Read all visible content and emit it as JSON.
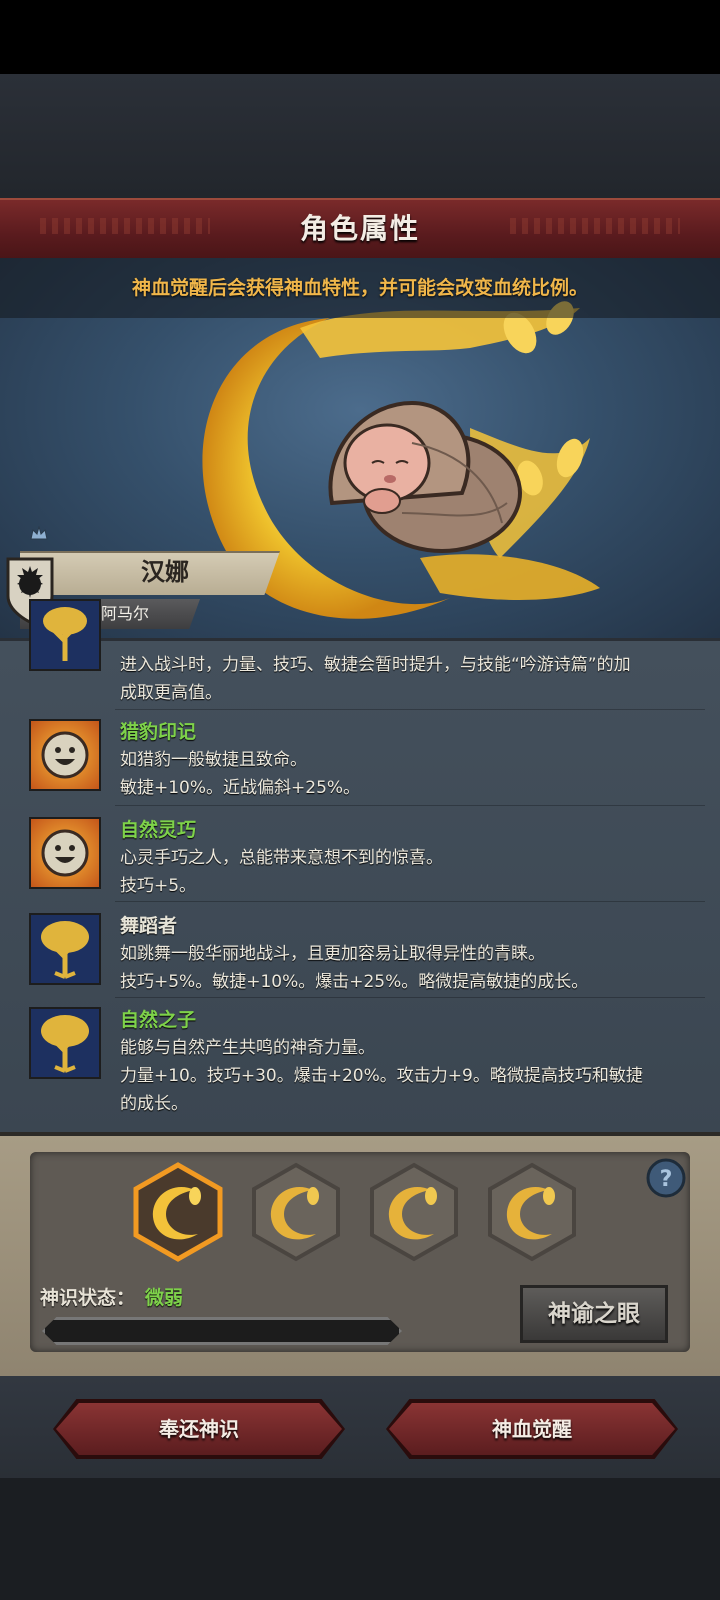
{
  "header": {
    "title": "角色属性"
  },
  "hint": "神血觉醒后会获得神血特性，并可能会改变血统比例。",
  "character": {
    "name": "汉娜",
    "lineage": "阿马尔"
  },
  "traits": [
    {
      "name": "",
      "lines": [
        "进入战斗时，力量、技巧、敏捷会暂时提升，与技能“吟游诗篇”的加",
        "成取更高值。"
      ],
      "icon": "tree-icon"
    },
    {
      "name": "猎豹印记",
      "lines": [
        "如猎豹一般敏捷且致命。",
        "敏捷+10%。近战偏斜+25%。"
      ],
      "icon": "smiley-icon"
    },
    {
      "name": "自然灵巧",
      "lines": [
        "心灵手巧之人，总能带来意想不到的惊喜。",
        "技巧+5。"
      ],
      "icon": "smiley-icon"
    },
    {
      "name": "舞蹈者",
      "lines": [
        "如跳舞一般华丽地战斗，且更加容易让取得异性的青睐。",
        "技巧+5%。敏捷+10%。爆击+25%。略微提高敏捷的成长。"
      ],
      "icon": "tree-icon"
    },
    {
      "name": "自然之子",
      "lines": [
        "能够与自然产生共鸣的神奇力量。",
        "力量+10。技巧+30。爆击+20%。攻击力+9。略微提高技巧和敏捷",
        "的成长。"
      ],
      "icon": "tree-icon"
    }
  ],
  "divine": {
    "status_label": "神识状态：",
    "status_value": "微弱",
    "progress": 0.0,
    "oracle_button": "神谕之眼",
    "slots": [
      "crescent-icon",
      "crescent-icon",
      "crescent-icon",
      "crescent-icon"
    ]
  },
  "actions": {
    "return_label": "奉还神识",
    "awaken_label": "神血觉醒"
  },
  "colors": {
    "accent_green": "#7ed24a",
    "hint_orange": "#f0b64a",
    "header_red": "#6a2224"
  }
}
